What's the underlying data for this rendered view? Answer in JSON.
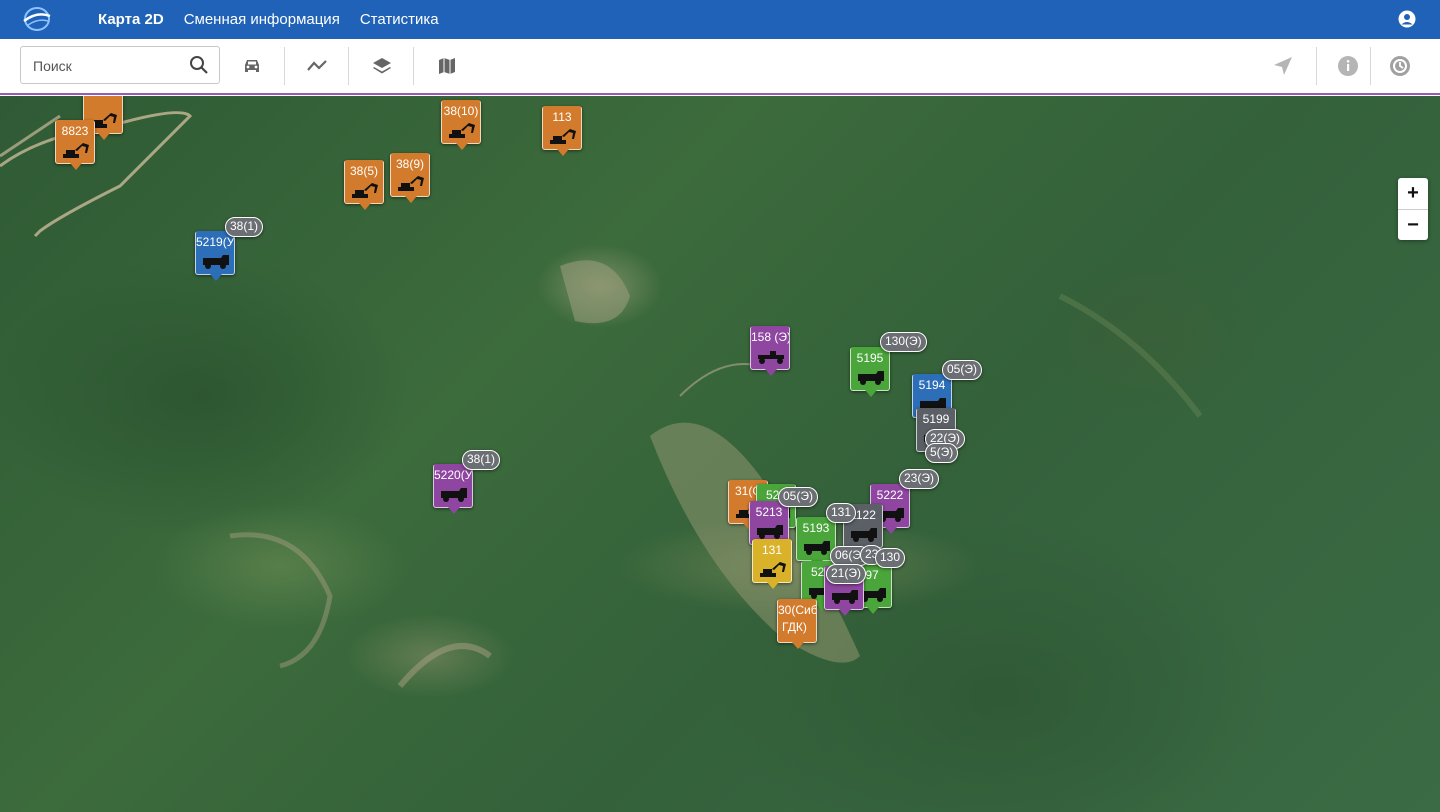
{
  "header": {
    "nav": [
      "Карта 2D",
      "Сменная информация",
      "Статистика"
    ]
  },
  "toolbar": {
    "search_placeholder": "Поиск"
  },
  "map": {
    "zoom_in": "+",
    "zoom_out": "−",
    "markers": [
      {
        "label": "",
        "color": "#d37b2c",
        "type": "excavator"
      },
      {
        "label": "8823",
        "color": "#d37b2c",
        "type": "excavator"
      },
      {
        "label": "38(10)",
        "color": "#d37b2c",
        "type": "excavator"
      },
      {
        "label": "113",
        "color": "#d37b2c",
        "type": "excavator"
      },
      {
        "label": "38(5)",
        "color": "#d37b2c",
        "type": "excavator"
      },
      {
        "label": "38(9)",
        "color": "#d37b2c",
        "type": "excavator"
      },
      {
        "label": "5219(У",
        "color": "#2c6fb8",
        "type": "truck"
      },
      {
        "label": "158 (Э)",
        "color": "#8e46a0",
        "type": "grader"
      },
      {
        "label": "5195",
        "color": "#4aa53a",
        "type": "truck"
      },
      {
        "label": "5194",
        "color": "#2c6fb8",
        "type": "truck"
      },
      {
        "label": "5199",
        "color": "#5b5f66",
        "type": "truck"
      },
      {
        "label": "5220(У",
        "color": "#8e46a0",
        "type": "truck"
      },
      {
        "label": "31(С",
        "color": "#d37b2c",
        "type": "excavator"
      },
      {
        "label": "522",
        "color": "#4aa53a",
        "type": "truck"
      },
      {
        "label": "5213",
        "color": "#8e46a0",
        "type": "truck"
      },
      {
        "label": "5222",
        "color": "#8e46a0",
        "type": "truck"
      },
      {
        "label": "5193",
        "color": "#4aa53a",
        "type": "truck"
      },
      {
        "label": "1122",
        "color": "#5b5f66",
        "type": "truck"
      },
      {
        "label": "131",
        "color": "#d9b22a",
        "type": "excavator"
      },
      {
        "label": "521",
        "color": "#4aa53a",
        "type": "truck"
      },
      {
        "label": "97",
        "color": "#4aa53a",
        "type": "truck"
      },
      {
        "label": "30(Сиб",
        "color": "#d37b2c",
        "type": "excavator"
      }
    ],
    "bubbles": [
      "38(1)",
      "130(Э)",
      "05(Э)",
      "22(Э)",
      "5(Э)",
      "23(Э)",
      "05(Э)",
      "131",
      "06(Э)",
      "21(Э)",
      "23",
      "130",
      "38(1)"
    ],
    "marker_extra_text": "ГДК)"
  }
}
